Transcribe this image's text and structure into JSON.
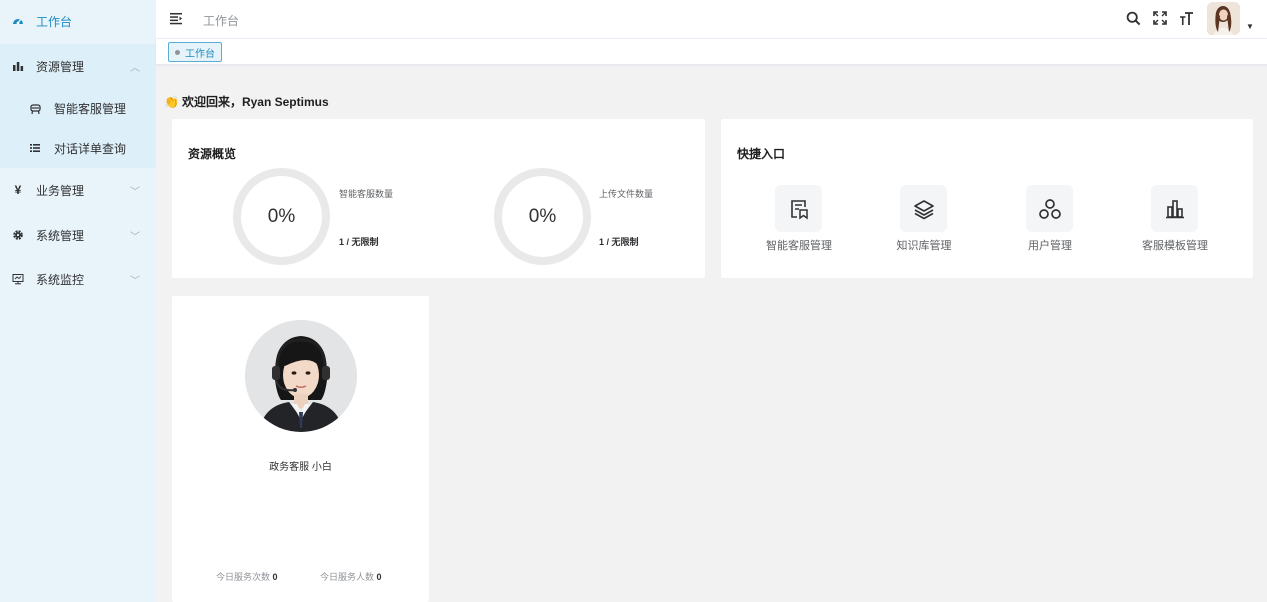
{
  "sidebar": {
    "items": [
      {
        "label": "工作台",
        "icon": "dashboard-icon"
      },
      {
        "label": "资源管理",
        "icon": "bar-chart-icon"
      },
      {
        "label": "智能客服管理",
        "icon": "robot-icon"
      },
      {
        "label": "对话详单查询",
        "icon": "list-icon"
      },
      {
        "label": "业务管理",
        "icon": "yen-icon"
      },
      {
        "label": "系统管理",
        "icon": "gear-icon"
      },
      {
        "label": "系统监控",
        "icon": "monitor-icon"
      }
    ]
  },
  "header": {
    "breadcrumb": "工作台"
  },
  "tags": [
    {
      "label": "工作台"
    }
  ],
  "welcome": {
    "emoji": "👏",
    "text": "欢迎回来，Ryan Septimus"
  },
  "overview": {
    "title": "资源概览",
    "stats": [
      {
        "percent": "0%",
        "label": "智能客服数量",
        "value": "1 / 无限制"
      },
      {
        "percent": "0%",
        "label": "上传文件数量",
        "value": "1 / 无限制"
      }
    ]
  },
  "quick": {
    "title": "快捷入口",
    "entries": [
      {
        "label": "智能客服管理",
        "icon": "document-icon"
      },
      {
        "label": "知识库管理",
        "icon": "layers-icon"
      },
      {
        "label": "用户管理",
        "icon": "users-icon"
      },
      {
        "label": "客服模板管理",
        "icon": "chart-icon"
      }
    ]
  },
  "agent": {
    "name": "政务客服 小白",
    "today_service_count_label": "今日服务次数",
    "today_service_count": "0",
    "today_service_people_label": "今日服务人数",
    "today_service_people": "0"
  },
  "colors": {
    "accent": "#1c8bc0",
    "sidebar_bg": "#e8f4fa"
  }
}
